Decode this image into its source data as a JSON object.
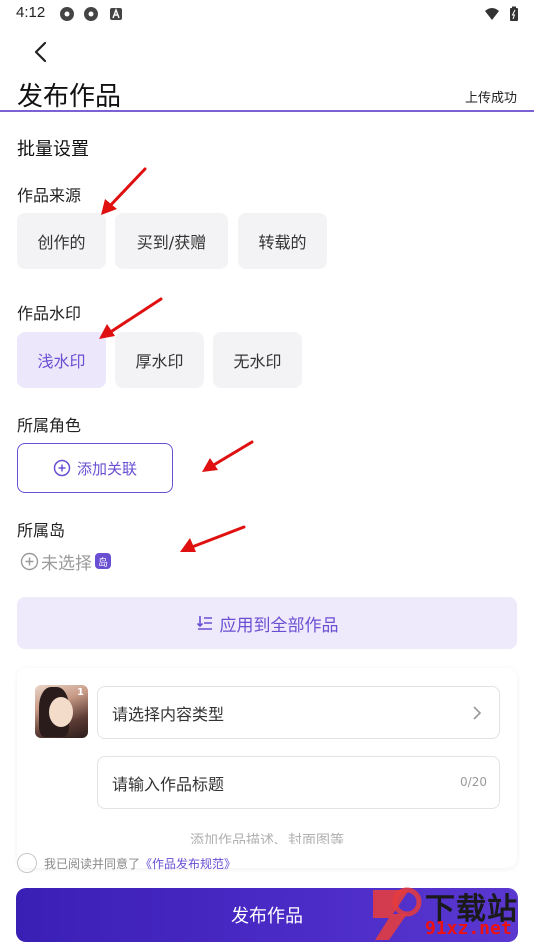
{
  "status_bar": {
    "time": "4:12",
    "left_icons": [
      "settings-gear-icon",
      "settings-gear-icon",
      "a-box-icon"
    ],
    "right_icons": [
      "wifi-icon",
      "battery-icon"
    ]
  },
  "header": {
    "back_icon": "chevron-left-icon",
    "title": "发布作品",
    "upload_status": "上传成功",
    "accent_color": "#6a4fd3"
  },
  "batch": {
    "heading": "批量设置",
    "source": {
      "label": "作品来源",
      "options": [
        "创作的",
        "买到/获赠",
        "转载的"
      ],
      "selected": ""
    },
    "watermark": {
      "label": "作品水印",
      "options": [
        "浅水印",
        "厚水印",
        "无水印"
      ],
      "selected": "浅水印"
    },
    "role": {
      "label": "所属角色",
      "add_button": "添加关联",
      "add_icon": "plus-circle-icon"
    },
    "island": {
      "label": "所属岛",
      "value": "未选择",
      "badge": "岛",
      "add_icon": "plus-circle-icon"
    },
    "apply_all": "应用到全部作品",
    "apply_icon": "list-apply-icon"
  },
  "work_card": {
    "thumb_index": "1",
    "content_type_placeholder": "请选择内容类型",
    "title_placeholder": "请输入作品标题",
    "title_counter": "0/20",
    "desc_hint": "添加作品描述、封面图等"
  },
  "footer": {
    "agree_text": "我已阅读并同意了",
    "agree_link": "《作品发布规范》",
    "publish_button": "发布作品"
  },
  "watermark_logo": {
    "text": "下载站",
    "url": "91xz.net"
  }
}
